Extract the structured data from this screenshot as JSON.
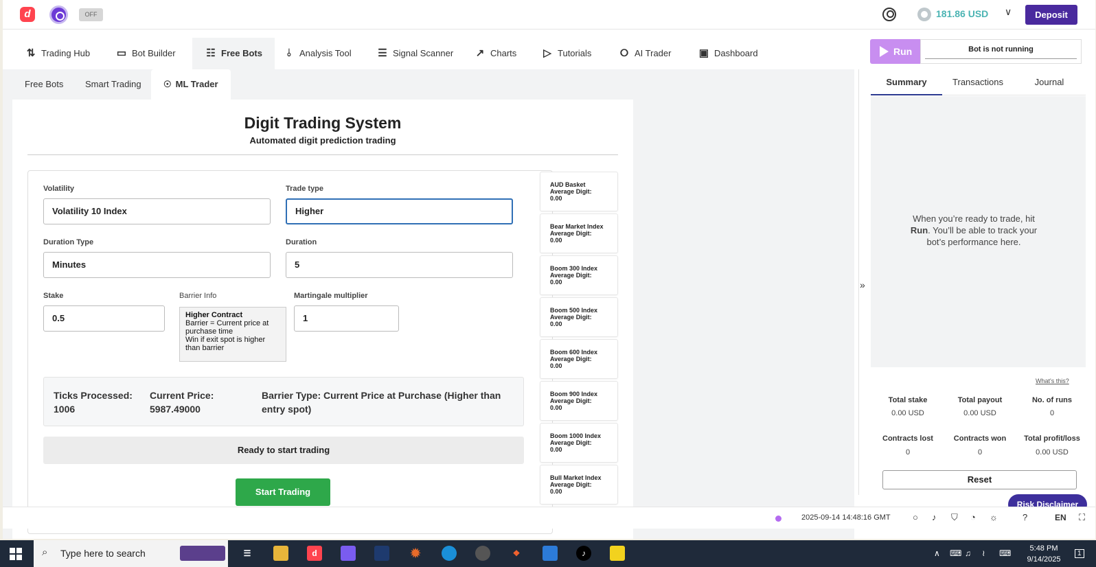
{
  "header": {
    "toggle_label": "OFF",
    "balance": "181.86 USD",
    "deposit_label": "Deposit"
  },
  "main_nav": [
    {
      "label": "Trading Hub",
      "icon": "arrows-icon"
    },
    {
      "label": "Bot Builder",
      "icon": "builder-icon"
    },
    {
      "label": "Free Bots",
      "icon": "grid-icon"
    },
    {
      "label": "Analysis Tool",
      "icon": "analysis-icon"
    },
    {
      "label": "Signal Scanner",
      "icon": "list-icon"
    },
    {
      "label": "Charts",
      "icon": "chart-icon"
    },
    {
      "label": "Tutorials",
      "icon": "play-icon"
    },
    {
      "label": "AI Trader",
      "icon": "layers-icon"
    },
    {
      "label": "Dashboard",
      "icon": "dashboard-icon"
    }
  ],
  "sub_nav": [
    {
      "label": "Free Bots"
    },
    {
      "label": "Smart Trading"
    },
    {
      "label": "ML Trader"
    }
  ],
  "trader": {
    "title": "Digit Trading System",
    "subtitle": "Automated digit prediction trading",
    "volatility_label": "Volatility",
    "volatility_value": "Volatility 10 Index",
    "trade_type_label": "Trade type",
    "trade_type_value": "Higher",
    "duration_type_label": "Duration Type",
    "duration_type_value": "Minutes",
    "duration_label": "Duration",
    "duration_value": "5",
    "stake_label": "Stake",
    "stake_value": "0.5",
    "barrier_label": "Barrier Info",
    "barrier_title": "Higher Contract",
    "barrier_line1": "Barrier = Current price at purchase time",
    "barrier_line2": "Win if exit spot is higher than barrier",
    "martingale_label": "Martingale multiplier",
    "martingale_value": "1",
    "ticks": "Ticks Processed: 1006",
    "current_price": "Current Price: 5987.49000",
    "barrier_type": "Barrier Type: Current Price at Purchase (Higher than entry spot)",
    "status": "Ready to start trading",
    "start_label": "Start Trading"
  },
  "markets": [
    {
      "name": "AUD Basket",
      "avg": "Average Digit:",
      "value": "0.00"
    },
    {
      "name": "Bear Market Index",
      "avg": "Average Digit:",
      "value": "0.00"
    },
    {
      "name": "Boom 300 Index",
      "avg": "Average Digit:",
      "value": "0.00"
    },
    {
      "name": "Boom 500 Index",
      "avg": "Average Digit:",
      "value": "0.00"
    },
    {
      "name": "Boom 600 Index",
      "avg": "Average Digit:",
      "value": "0.00"
    },
    {
      "name": "Boom 900 Index",
      "avg": "Average Digit:",
      "value": "0.00"
    },
    {
      "name": "Boom 1000 Index",
      "avg": "Average Digit:",
      "value": "0.00"
    },
    {
      "name": "Bull Market Index",
      "avg": "Average Digit:",
      "value": "0.00"
    }
  ],
  "run_panel": {
    "run_label": "Run",
    "bot_status": "Bot is not running",
    "tabs": [
      "Summary",
      "Transactions",
      "Journal"
    ],
    "empty_line1": "When you’re ready to trade, hit ",
    "empty_run": "Run",
    "empty_line2": ". You’ll be able to track your bot’s performance here.",
    "whats_this": "What's this?",
    "stats": [
      {
        "label": "Total stake",
        "value": "0.00 USD"
      },
      {
        "label": "Total payout",
        "value": "0.00 USD"
      },
      {
        "label": "No. of runs",
        "value": "0"
      },
      {
        "label": "Contracts lost",
        "value": "0"
      },
      {
        "label": "Contracts won",
        "value": "0"
      },
      {
        "label": "Total profit/loss",
        "value": "0.00 USD"
      }
    ],
    "reset_label": "Reset",
    "risk_label": "Risk Disclaimer"
  },
  "footer": {
    "timestamp": "2025-09-14 14:48:16 GMT",
    "lang": "EN"
  },
  "taskbar": {
    "search_placeholder": "Type here to search",
    "time": "5:48 PM",
    "date": "9/14/2025",
    "notifications": "1"
  }
}
